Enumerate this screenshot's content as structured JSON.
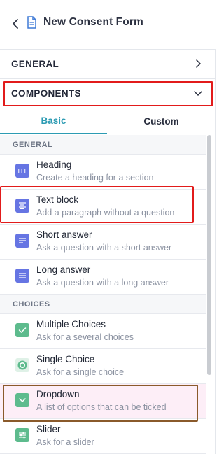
{
  "header": {
    "title": "New Consent Form",
    "back_icon": "chevron-left-icon",
    "doc_icon": "document-icon"
  },
  "sections": {
    "general": {
      "label": "GENERAL",
      "icon": "chevron-right-icon"
    },
    "components": {
      "label": "COMPONENTS",
      "icon": "chevron-down-icon"
    }
  },
  "tabs": [
    {
      "label": "Basic",
      "active": true
    },
    {
      "label": "Custom",
      "active": false
    }
  ],
  "groups": {
    "general": "GENERAL",
    "choices": "CHOICES"
  },
  "items": [
    {
      "name": "Heading",
      "desc": "Create a heading for a section",
      "icon": "h1-icon"
    },
    {
      "name": "Text block",
      "desc": "Add a paragraph without a question",
      "icon": "text-align-icon"
    },
    {
      "name": "Short answer",
      "desc": "Ask a question with a short answer",
      "icon": "short-text-icon"
    },
    {
      "name": "Long answer",
      "desc": "Ask a question with a long answer",
      "icon": "long-text-icon"
    },
    {
      "name": "Multiple Choices",
      "desc": "Ask for a several choices",
      "icon": "checkbox-icon"
    },
    {
      "name": "Single Choice",
      "desc": "Ask for a single choice",
      "icon": "radio-icon"
    },
    {
      "name": "Dropdown",
      "desc": "A list of options that can be ticked",
      "icon": "dropdown-icon"
    },
    {
      "name": "Slider",
      "desc": "Ask for a slider",
      "icon": "slider-icon"
    }
  ],
  "colors": {
    "accent": "#2c9bb3",
    "blue_icon": "#6675e3",
    "green_icon": "#5dbb8d",
    "highlight_red": "#e21b1b",
    "highlight_brown": "#8a5a2b"
  }
}
